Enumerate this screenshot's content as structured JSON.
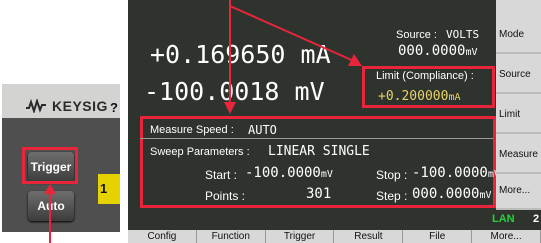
{
  "panel": {
    "brand": "KEYSIG",
    "qmark": "?",
    "trigger_label": "Trigger",
    "auto_label": "Auto",
    "side_number": "1"
  },
  "display": {
    "primary": "+0.169650 mA",
    "secondary": "-100.0018 mV",
    "source_label": "Source :",
    "source_mode": "VOLTS",
    "source_value": "000.0000",
    "source_unit": "mV",
    "limit_label": "Limit (Compliance) :",
    "limit_value": "+0.200000",
    "limit_unit": "mA",
    "measure_speed_label": "Measure Speed :",
    "measure_speed_value": "AUTO",
    "sweep_label": "Sweep Parameters :",
    "sweep_value": "LINEAR SINGLE",
    "start_label": "Start :",
    "start_value": "-100.0000",
    "start_unit": "mV",
    "stop_label": "Stop :",
    "stop_value": "-100.0000",
    "stop_unit": "mV",
    "points_label": "Points :",
    "points_value": "301",
    "step_label": "Step :",
    "step_value": "000.0000",
    "step_unit": "mV",
    "lan": "LAN",
    "lan_num": "2"
  },
  "softkeys": [
    "Mode",
    "Source",
    "Limit",
    "Measure",
    "More..."
  ],
  "bottom_keys": [
    "Config",
    "Function",
    "Trigger",
    "Result",
    "File",
    "More..."
  ],
  "colors": {
    "highlight": "#e8253a",
    "limit_value": "#e8d26a",
    "lan": "#28d23a"
  }
}
